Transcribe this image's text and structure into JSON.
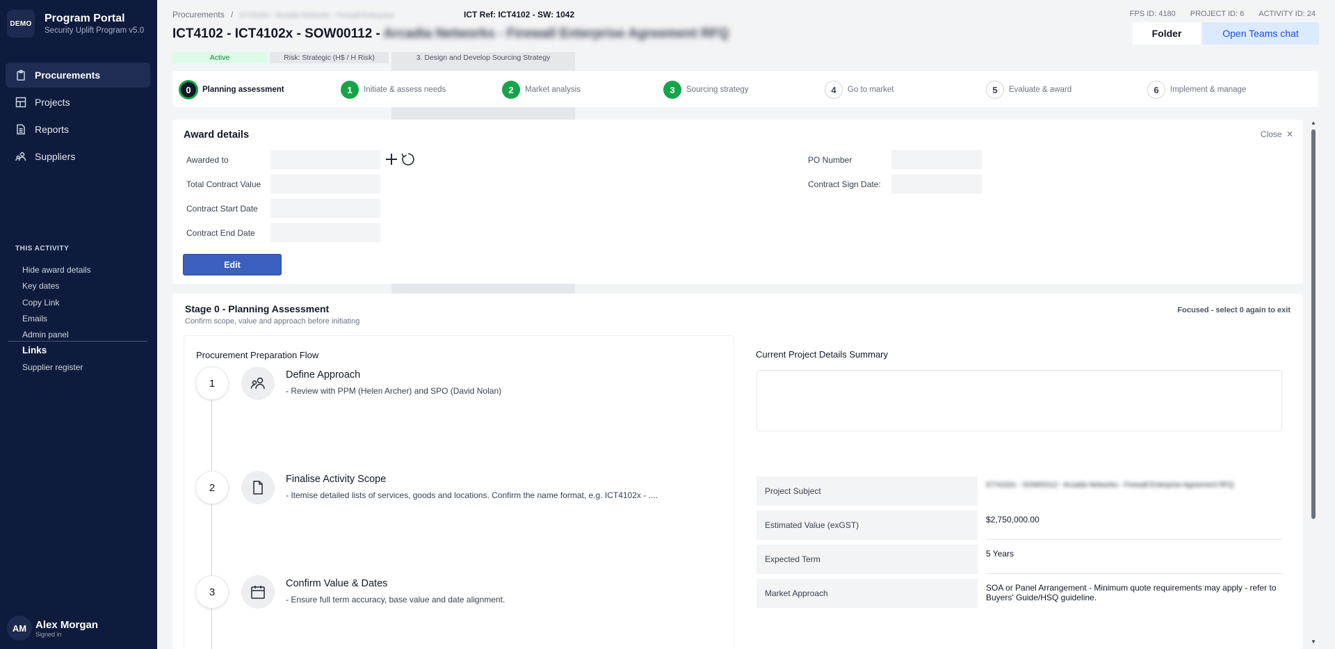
{
  "brand": {
    "logo": "DEMO",
    "title": "Program Portal",
    "subtitle": "Security Uplift Program v5.0"
  },
  "nav": [
    {
      "label": "Procurements",
      "icon": "clipboard-icon",
      "active": true
    },
    {
      "label": "Projects",
      "icon": "grid-icon"
    },
    {
      "label": "Reports",
      "icon": "document-icon"
    },
    {
      "label": "Suppliers",
      "icon": "users-icon"
    }
  ],
  "activity": {
    "label": "THIS ACTIVITY",
    "items": [
      "Hide award details",
      "Key dates",
      "Copy Link",
      "Emails",
      "Admin panel"
    ]
  },
  "links": {
    "title": "Links",
    "items": [
      "Supplier register"
    ]
  },
  "user": {
    "initials": "AM",
    "name": "Alex Morgan",
    "status": "Signed in"
  },
  "header": {
    "breadcrumb_root": "Procurements",
    "breadcrumb_sep": "/",
    "breadcrumb_current": "ICT4102x - Arcadia Networks - Firewall Enterprise",
    "ict_ref": "ICT Ref: ICT4102 - SW: 1042",
    "fps_id": "FPS ID: 4180",
    "project_id": "PROJECT ID: 6",
    "activity_id": "ACTIVITY ID: 24",
    "title": "ICT4102 - ICT4102x - SOW00112 -",
    "title_hidden": "Arcadia Networks - Firewall Enterprise Agreement RFQ",
    "folder_btn": "Folder",
    "teams_btn": "Open Teams chat"
  },
  "badges": {
    "status": "Active",
    "risk": "Risk: Strategic (H$ / H Risk)",
    "stage": "3. Design and Develop Sourcing Strategy"
  },
  "stepper": [
    {
      "num": "0",
      "label": "Planning assessment",
      "state": "cur"
    },
    {
      "num": "1",
      "label": "Initiate & assess needs",
      "state": "done"
    },
    {
      "num": "2",
      "label": "Market analysis",
      "state": "done"
    },
    {
      "num": "3",
      "label": "Sourcing strategy",
      "state": "done"
    },
    {
      "num": "4",
      "label": "Go to market",
      "state": "todo"
    },
    {
      "num": "5",
      "label": "Evaluate & award",
      "state": "todo"
    },
    {
      "num": "6",
      "label": "Implement & manage",
      "state": "todo"
    }
  ],
  "award": {
    "title": "Award details",
    "close": "Close",
    "fields": {
      "awarded_to": "Awarded to",
      "total_value": "Total Contract Value",
      "start_date": "Contract Start Date",
      "end_date": "Contract End Date",
      "po_number": "PO Number",
      "sign_date": "Contract Sign Date:"
    },
    "edit_btn": "Edit"
  },
  "stage": {
    "title": "Stage 0 - Planning Assessment",
    "subtitle": "Confirm scope, value and approach before initiating",
    "focused": "Focused - select 0 again to exit"
  },
  "flow": {
    "title": "Procurement Preparation Flow",
    "steps": [
      {
        "num": "1",
        "title": "Define Approach",
        "desc": "- Review with PPM (Helen Archer) and SPO (David Nolan)",
        "icon": "people-icon"
      },
      {
        "num": "2",
        "title": "Finalise Activity Scope",
        "desc": "- Itemise detailed lists of services, goods and locations. Confirm the name format, e.g. ICT4102x - ....",
        "icon": "file-icon"
      },
      {
        "num": "3",
        "title": "Confirm Value & Dates",
        "desc": "- Ensure full term accuracy, base value and date alignment.",
        "icon": "calendar-icon"
      }
    ]
  },
  "summary": {
    "title": "Current Project Details Summary",
    "rows": [
      {
        "key": "Project Subject",
        "value": "ICT4102x - SOW00112 - Arcadia Networks - Firewall Enterprise Agreement RFQ",
        "hidden": true
      },
      {
        "key": "Estimated Value (exGST)",
        "value": "$2,750,000.00"
      },
      {
        "key": "Expected Term",
        "value": "5 Years"
      },
      {
        "key": "Market Approach",
        "value": "SOA or Panel Arrangement - Minimum quote requirements may apply - refer to Buyers' Guide/HSQ guideline."
      }
    ]
  }
}
